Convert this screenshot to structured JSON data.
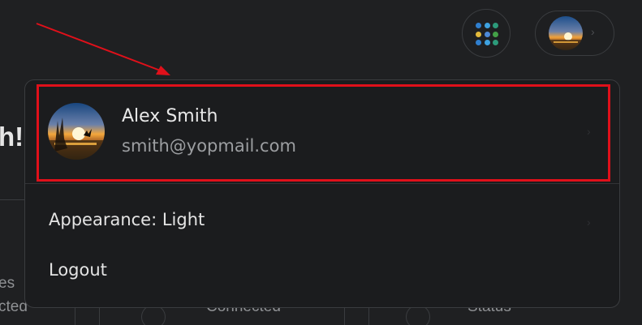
{
  "background": {
    "heading_fragment": "h!",
    "text_fragment_1": "es",
    "text_fragment_2": "cted",
    "card_label_1": "Connected",
    "card_label_2": "Status"
  },
  "topbar": {
    "apps_icon": "grid-apps-icon",
    "profile_icon": "avatar-sunset-icon",
    "apps_dot_colors": [
      "#2f7fcf",
      "#3ea2e0",
      "#2c9a7a",
      "#e2b93b",
      "#4c89d8",
      "#43a047",
      "#2f7fcf",
      "#3ea2e0",
      "#2c9a7a"
    ]
  },
  "annotation": {
    "color": "#e0101a"
  },
  "menu": {
    "user": {
      "name": "Alex Smith",
      "email": "smith@yopmail.com"
    },
    "items": [
      {
        "label": "Appearance: Light"
      },
      {
        "label": "Logout"
      }
    ]
  }
}
